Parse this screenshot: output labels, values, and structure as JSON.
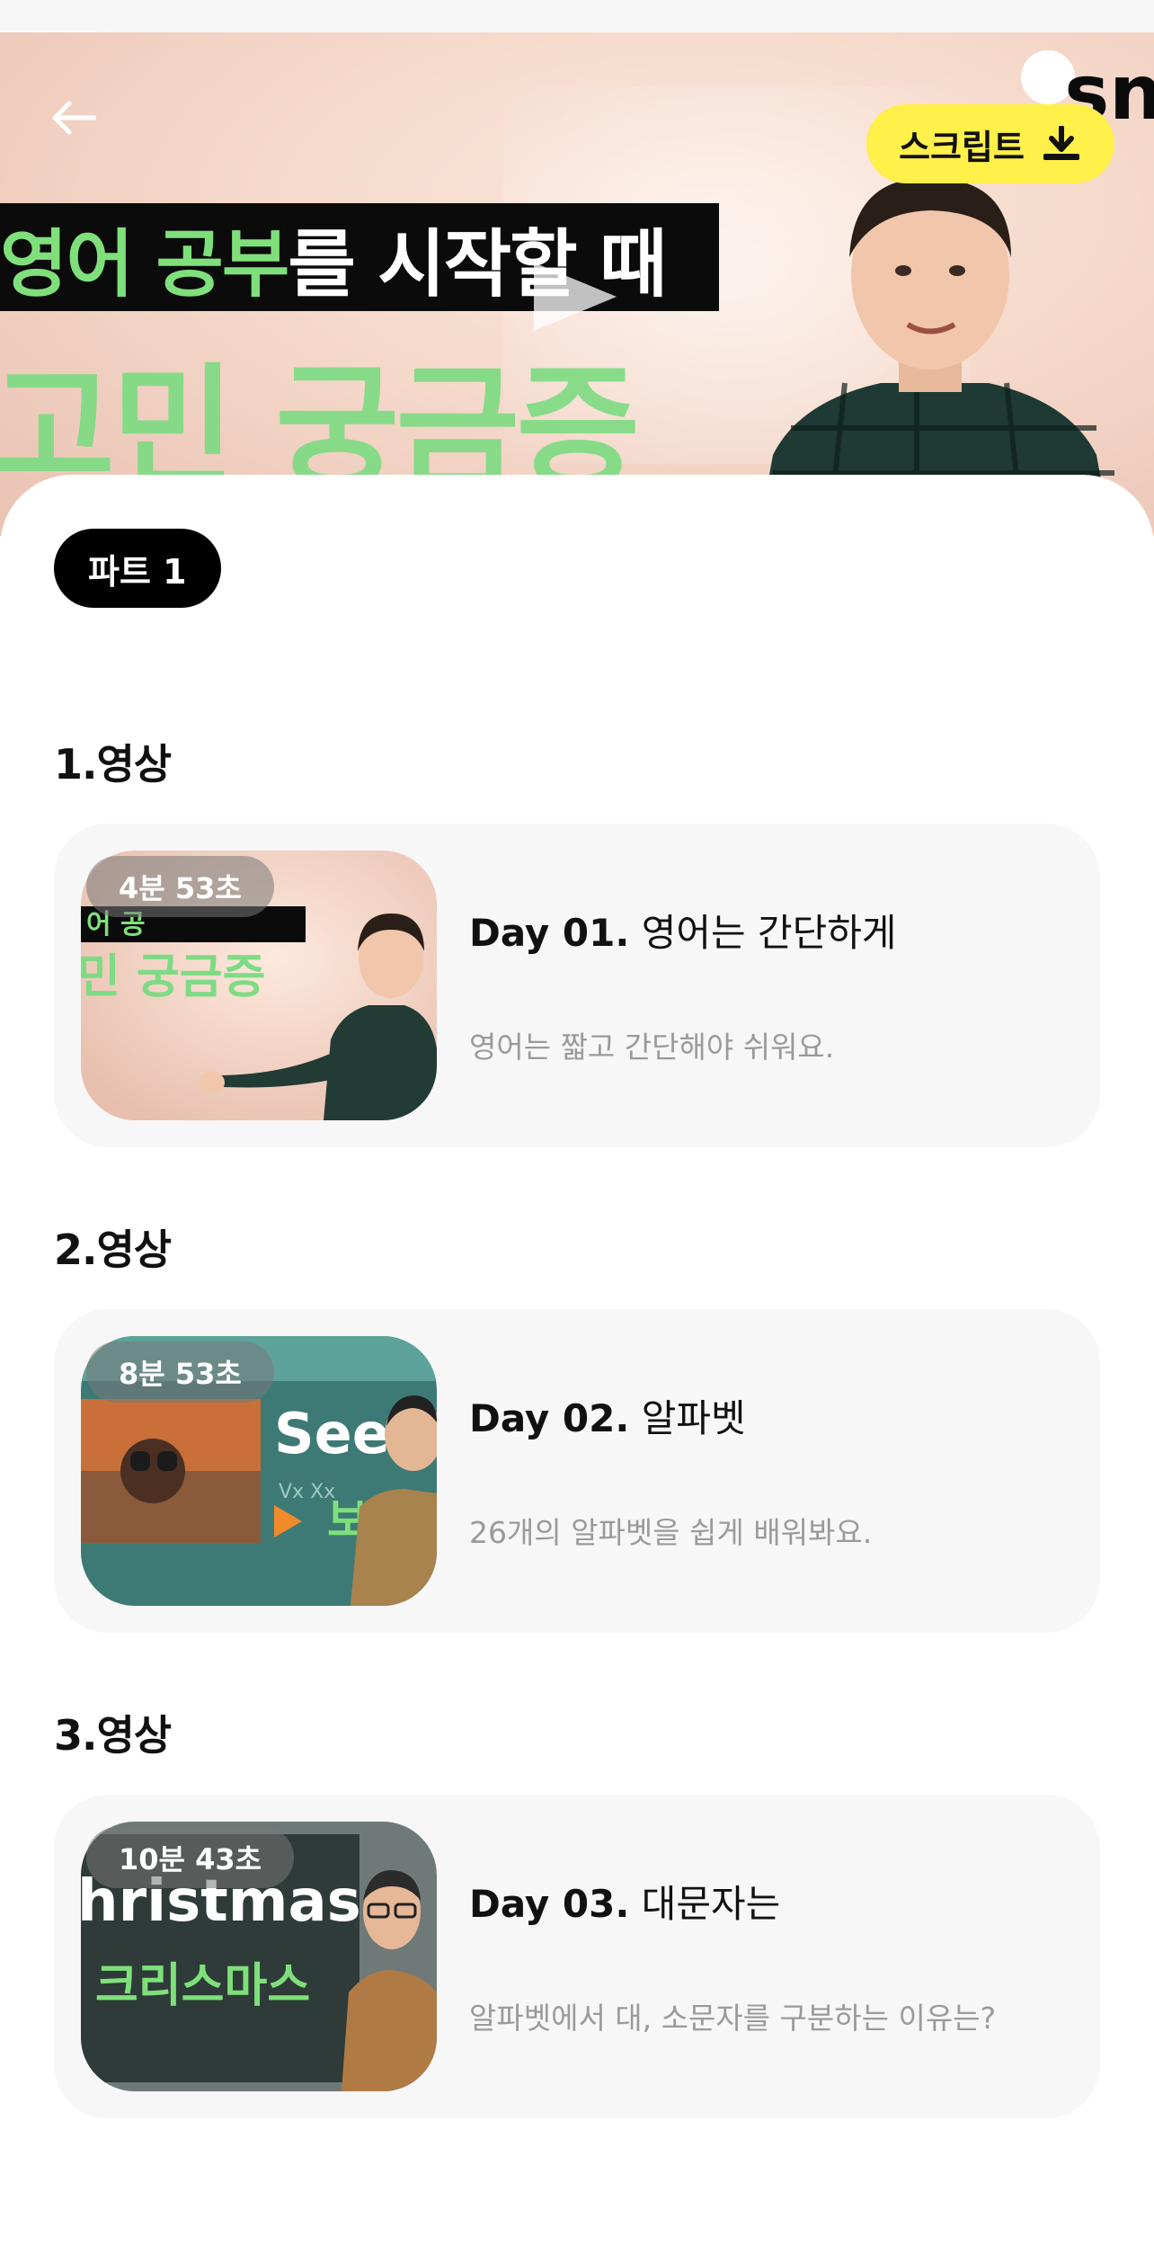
{
  "hero": {
    "headline_green": "영어 공부",
    "headline_white": "를 시작할 때",
    "big_text": "고민 궁금증",
    "logo_text": "sn",
    "script_button_label": "스크립트",
    "colors": {
      "accent_yellow": "#fff04a",
      "green": "#7edb83"
    }
  },
  "part": {
    "label": "파트 1"
  },
  "sections": [
    {
      "title": "1.영상",
      "duration": "4분 53초",
      "day": "Day 01.",
      "name": "영어는 간단하게",
      "description": "영어는 짧고 간단해야 쉬워요.",
      "thumb_text": "민 궁금증",
      "thumb_small_text": "어 공"
    },
    {
      "title": "2.영상",
      "duration": "8분 53초",
      "day": "Day 02.",
      "name": "알파벳",
      "description": "26개의 알파벳을 쉽게 배워봐요.",
      "thumb_text": "See",
      "thumb_text2": "보다",
      "thumb_small_text": "Vx Xx"
    },
    {
      "title": "3.영상",
      "duration": "10분 43초",
      "day": "Day 03.",
      "name": "대문자는",
      "description": "알파벳에서 대, 소문자를 구분하는 이유는?",
      "thumb_text": "hristmas",
      "thumb_text2": "크리스마스"
    }
  ],
  "icons": [
    "back-arrow-icon",
    "download-icon",
    "play-icon"
  ]
}
